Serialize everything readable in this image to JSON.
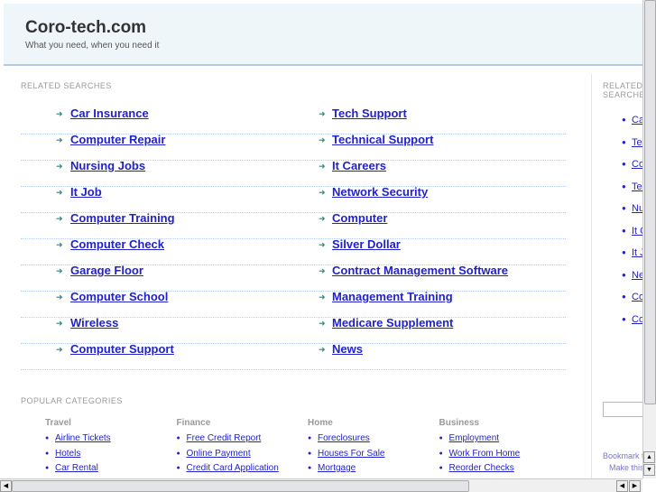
{
  "header": {
    "title": "Coro-tech.com",
    "tagline": "What you need, when you need it"
  },
  "related": {
    "heading": "RELATED SEARCHES",
    "left": [
      "Car Insurance",
      "Computer Repair",
      "Nursing Jobs",
      "It Job",
      "Computer Training",
      "Computer Check",
      "Garage Floor",
      "Computer School",
      "Wireless",
      "Computer Support"
    ],
    "right": [
      "Tech Support",
      "Technical Support",
      "It Careers",
      "Network Security",
      "Computer",
      "Silver Dollar",
      "Contract Management Software",
      "Management Training",
      "Medicare Supplement",
      "News"
    ]
  },
  "sidebar": {
    "heading": "RELATED SEARCHES",
    "items": [
      "Car Insurance",
      "Tech Support",
      "Computer Repair",
      "Technical Support",
      "Nursing Jobs",
      "It Careers",
      "It Job",
      "Network Security",
      "Computer Training",
      "Computer"
    ],
    "bookmark": "Bookmark this page",
    "homepage": "Make this your homepage"
  },
  "popular": {
    "heading": "POPULAR CATEGORIES",
    "columns": [
      {
        "title": "Travel",
        "items": [
          "Airline Tickets",
          "Hotels",
          "Car Rental"
        ]
      },
      {
        "title": "Finance",
        "items": [
          "Free Credit Report",
          "Online Payment",
          "Credit Card Application"
        ]
      },
      {
        "title": "Home",
        "items": [
          "Foreclosures",
          "Houses For Sale",
          "Mortgage"
        ]
      },
      {
        "title": "Business",
        "items": [
          "Employment",
          "Work From Home",
          "Reorder Checks"
        ]
      }
    ]
  }
}
